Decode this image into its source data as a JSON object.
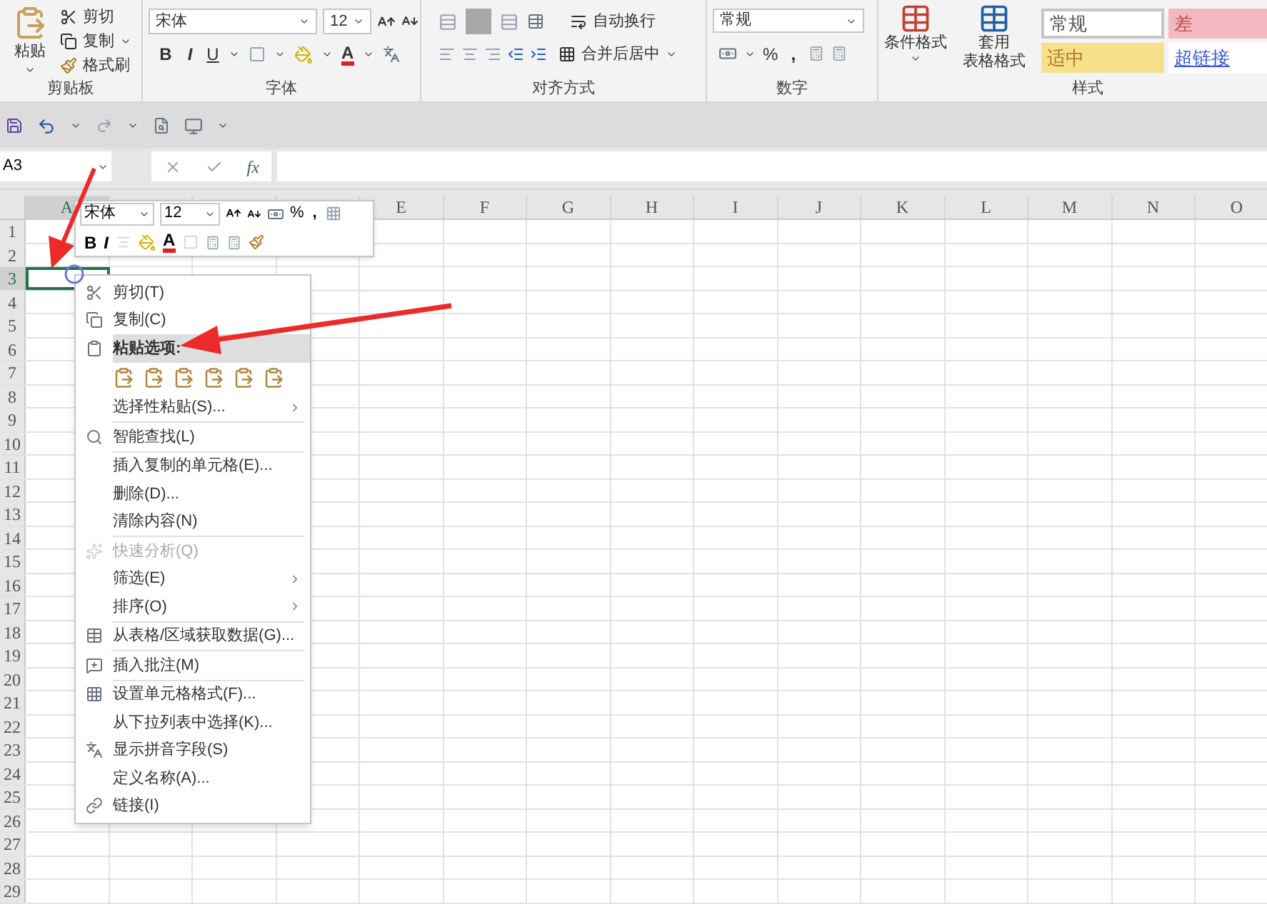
{
  "ribbon": {
    "clipboard": {
      "paste": "粘贴",
      "cut": "剪切",
      "copy": "复制",
      "format_painter": "格式刷",
      "label": "剪贴板"
    },
    "font": {
      "name": "宋体",
      "size": "12",
      "bold": "B",
      "italic": "I",
      "underline": "U",
      "font_color": "A",
      "label": "字体"
    },
    "alignment": {
      "wrap": "自动换行",
      "merge": "合并后居中",
      "label": "对齐方式"
    },
    "number": {
      "format": "常规",
      "percent": "%",
      "comma": ",",
      "label": "数字"
    },
    "styles": {
      "conditional": "条件格式",
      "table_line1": "套用",
      "table_line2": "表格格式",
      "label": "样式",
      "cells": [
        {
          "kind": "normal",
          "label": "常规"
        },
        {
          "kind": "bad",
          "label": "差"
        },
        {
          "kind": "neutral",
          "label": "适中"
        },
        {
          "kind": "link",
          "label": "超链接"
        }
      ]
    }
  },
  "name_box": "A3",
  "fx": "fx",
  "mini_toolbar": {
    "font": "宋体",
    "size": "12",
    "percent": "%",
    "comma": ",",
    "bold": "B",
    "italic": "I",
    "font_color": "A"
  },
  "sheet": {
    "columns": [
      {
        "label": "A",
        "selected": true
      },
      {},
      {},
      {},
      {
        "label": "E",
        "selected": false
      },
      {
        "label": "F",
        "selected": false
      },
      {
        "label": "G",
        "selected": false
      },
      {
        "label": "H",
        "selected": false
      },
      {
        "label": "I",
        "selected": false
      },
      {
        "label": "J",
        "selected": false
      },
      {
        "label": "K",
        "selected": false
      },
      {
        "label": "L",
        "selected": false
      },
      {
        "label": "M",
        "selected": false
      },
      {
        "label": "N",
        "selected": false
      },
      {
        "label": "O",
        "selected": false
      }
    ],
    "rows": [
      {
        "label": "1",
        "selected": false
      },
      {
        "label": "2",
        "selected": false
      },
      {
        "label": "3",
        "selected": true
      },
      {
        "label": "4",
        "selected": false
      },
      {
        "label": "5",
        "selected": false
      },
      {
        "label": "6",
        "selected": false
      },
      {
        "label": "7",
        "selected": false
      },
      {
        "label": "8",
        "selected": false
      },
      {
        "label": "9",
        "selected": false
      },
      {
        "label": "10",
        "selected": false
      },
      {
        "label": "11",
        "selected": false
      },
      {
        "label": "12",
        "selected": false
      },
      {
        "label": "13",
        "selected": false
      },
      {
        "label": "14",
        "selected": false
      },
      {
        "label": "15",
        "selected": false
      },
      {
        "label": "16",
        "selected": false
      },
      {
        "label": "17",
        "selected": false
      },
      {
        "label": "18",
        "selected": false
      },
      {
        "label": "19",
        "selected": false
      },
      {
        "label": "20",
        "selected": false
      },
      {
        "label": "21",
        "selected": false
      },
      {
        "label": "22",
        "selected": false
      },
      {
        "label": "23",
        "selected": false
      },
      {
        "label": "24",
        "selected": false
      },
      {
        "label": "25",
        "selected": false
      },
      {
        "label": "26",
        "selected": false
      },
      {
        "label": "27",
        "selected": false
      },
      {
        "label": "28",
        "selected": false
      },
      {
        "label": "29",
        "selected": false
      }
    ]
  },
  "context_menu": {
    "items": [
      {
        "kind": "item",
        "label": "剪切(T)",
        "selected": false,
        "disabled": false,
        "submenu": false
      },
      {
        "kind": "item",
        "label": "复制(C)",
        "selected": false,
        "disabled": false,
        "submenu": false
      },
      {
        "kind": "heading",
        "label": "粘贴选项:",
        "selected": true
      },
      {
        "kind": "paste"
      },
      {
        "kind": "item",
        "label": "选择性粘贴(S)...",
        "selected": false,
        "disabled": false,
        "submenu": true
      },
      {
        "kind": "separator"
      },
      {
        "kind": "item",
        "label": "智能查找(L)",
        "selected": false,
        "disabled": false,
        "submenu": false
      },
      {
        "kind": "separator"
      },
      {
        "kind": "item",
        "label": "插入复制的单元格(E)...",
        "selected": false,
        "disabled": false,
        "submenu": false
      },
      {
        "kind": "item",
        "label": "删除(D)...",
        "selected": false,
        "disabled": false,
        "submenu": false
      },
      {
        "kind": "item",
        "label": "清除内容(N)",
        "selected": false,
        "disabled": false,
        "submenu": false
      },
      {
        "kind": "separator"
      },
      {
        "kind": "item",
        "label": "快速分析(Q)",
        "selected": false,
        "disabled": true,
        "submenu": false
      },
      {
        "kind": "item",
        "label": "筛选(E)",
        "selected": false,
        "disabled": false,
        "submenu": true
      },
      {
        "kind": "item",
        "label": "排序(O)",
        "selected": false,
        "disabled": false,
        "submenu": true
      },
      {
        "kind": "separator"
      },
      {
        "kind": "item",
        "label": "从表格/区域获取数据(G)...",
        "selected": false,
        "disabled": false,
        "submenu": false
      },
      {
        "kind": "separator"
      },
      {
        "kind": "item",
        "label": "插入批注(M)",
        "selected": false,
        "disabled": false,
        "submenu": false
      },
      {
        "kind": "separator"
      },
      {
        "kind": "item",
        "label": "设置单元格格式(F)...",
        "selected": false,
        "disabled": false,
        "submenu": false
      },
      {
        "kind": "item",
        "label": "从下拉列表中选择(K)...",
        "selected": false,
        "disabled": false,
        "submenu": false
      },
      {
        "kind": "item",
        "label": "显示拼音字段(S)",
        "selected": false,
        "disabled": false,
        "submenu": false
      },
      {
        "kind": "item",
        "label": "定义名称(A)...",
        "selected": false,
        "disabled": false,
        "submenu": false
      },
      {
        "kind": "item",
        "label": "链接(I)",
        "selected": false,
        "disabled": false,
        "submenu": false
      }
    ]
  }
}
